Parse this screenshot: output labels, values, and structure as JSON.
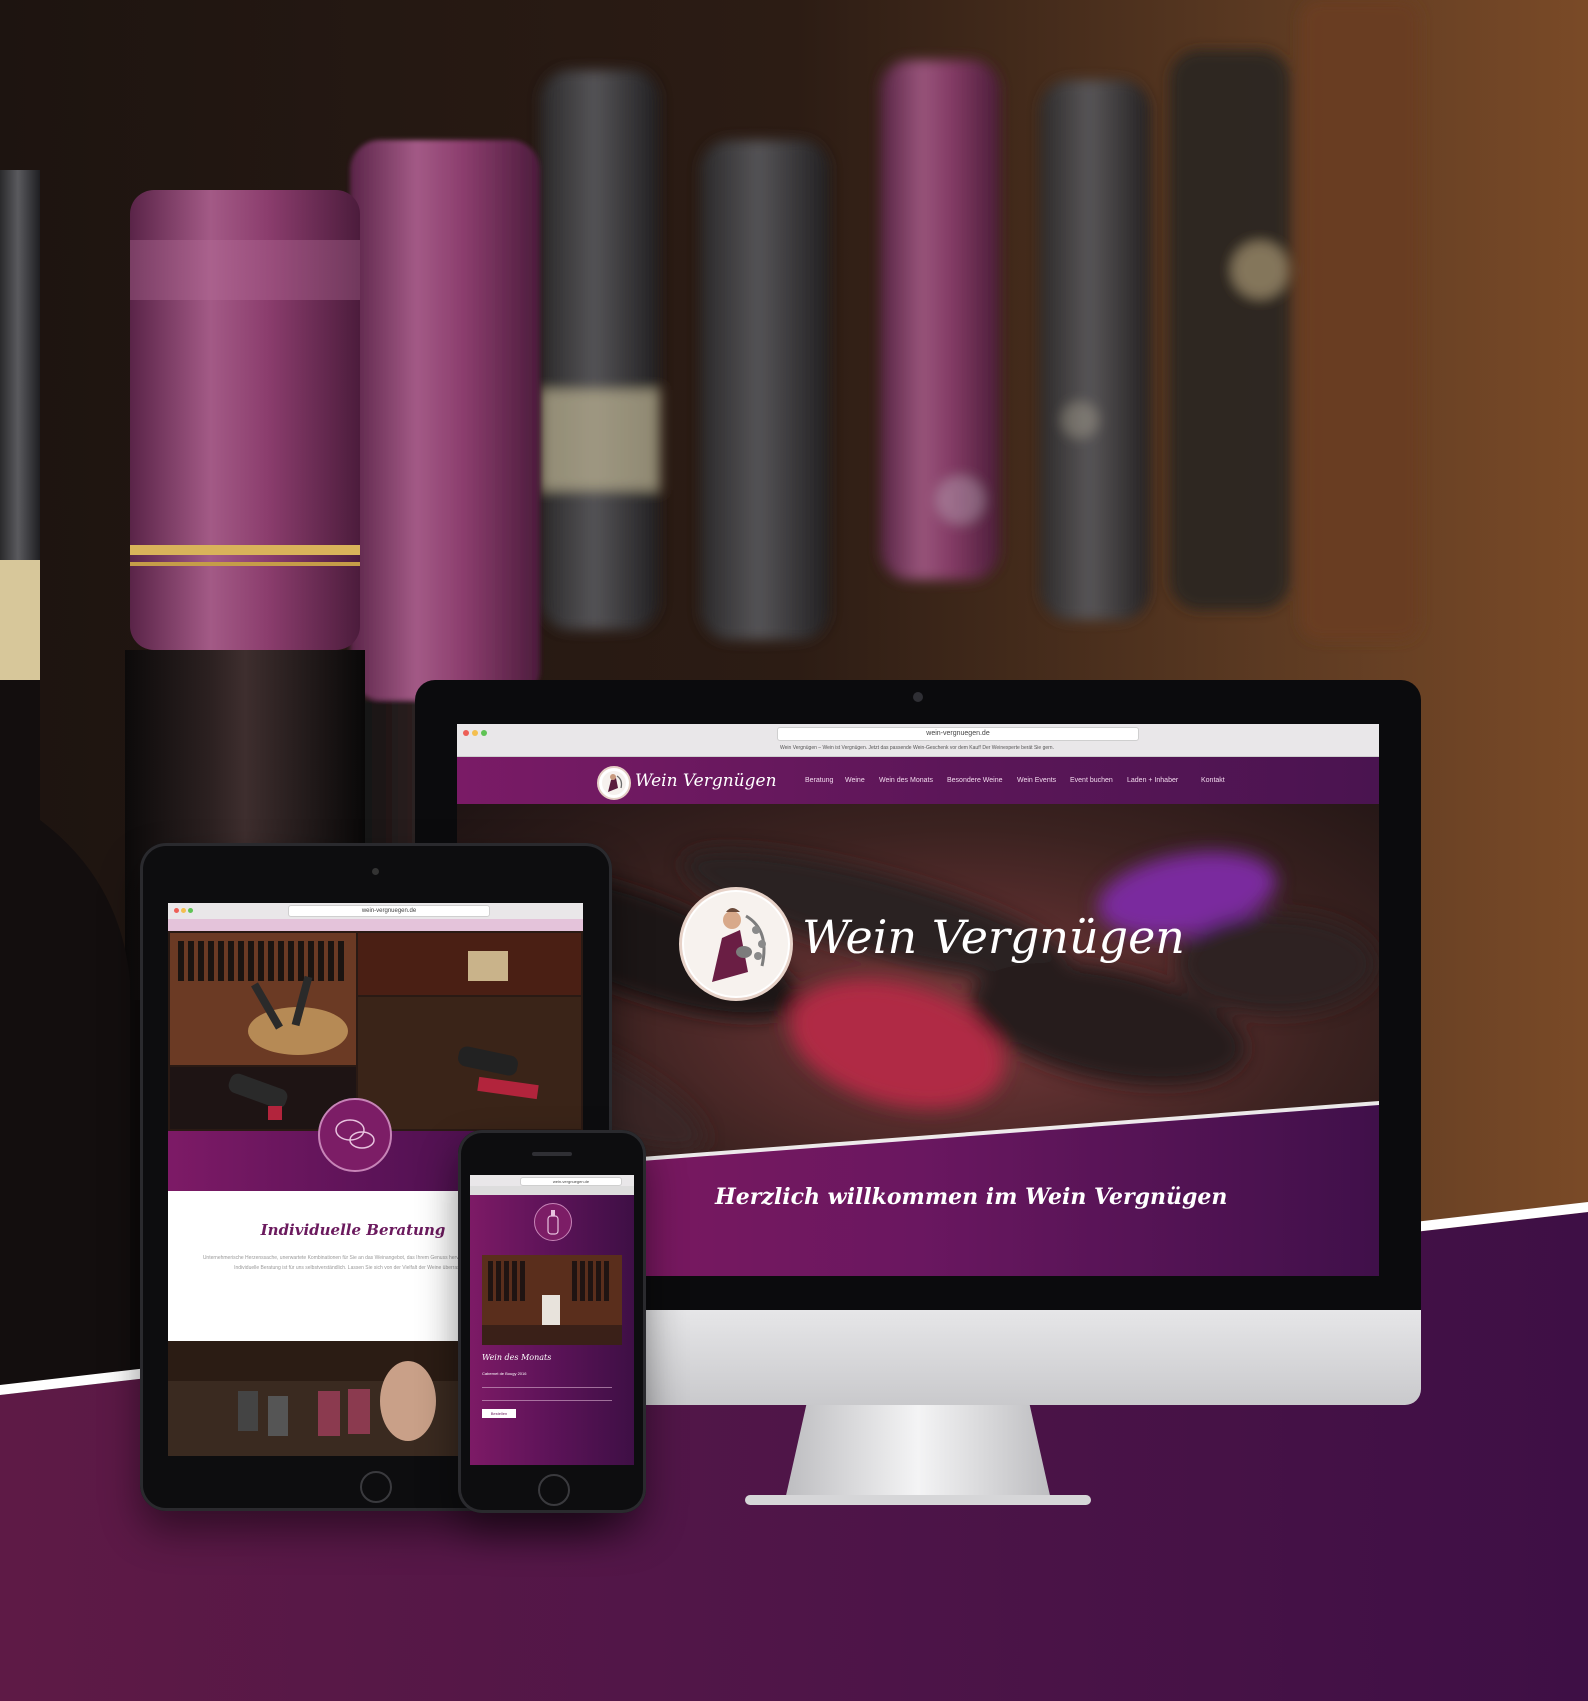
{
  "brand": {
    "name": "Wein Vergnügen",
    "colors": {
      "primary": "#6b1a5e",
      "dark": "#3e0f45",
      "accent": "#d4a5c8"
    }
  },
  "desktop": {
    "browser": {
      "url": "wein-vergnuegen.de",
      "notice": "Wein Vergnügen – Wein ist Vergnügen. Jetzt das passende Wein-Geschenk vor dem Kauf! Der Weinexperte berät Sie gern."
    },
    "nav": {
      "logo_text": "Wein Vergnügen",
      "items": [
        "Beratung",
        "Weine",
        "Wein des Monats",
        "Besondere Weine",
        "Wein Events",
        "Event buchen",
        "Laden + Inhaber",
        "Kontakt"
      ]
    },
    "hero": {
      "logo_text": "Wein Vergnügen",
      "welcome": "Herzlich willkommen im Wein Vergnügen"
    }
  },
  "tablet": {
    "browser": {
      "url": "wein-vergnuegen.de"
    },
    "section": {
      "title": "Individuelle Beratung",
      "text": "Unternehmerische Herzenssache, unerwartete Kombinationen für Sie an das Weinangebot, das Ihrem Genuss hervorragend entspricht. Individuelle Beratung ist für uns selbstverständlich. Lassen Sie sich von der Vielfalt der Weine überraschen."
    }
  },
  "phone": {
    "browser": {
      "url": "wein-vergnuegen.de"
    },
    "section": {
      "title": "Wein des Monats",
      "subtitle": "Cabernet de Bougy 2016",
      "button_label": "Bestellen"
    }
  },
  "icons": {
    "desktop_logo": "wine-maker-logo-icon",
    "tablet_chat": "chat-bubbles-icon",
    "phone_bottle": "wine-bottle-icon"
  }
}
